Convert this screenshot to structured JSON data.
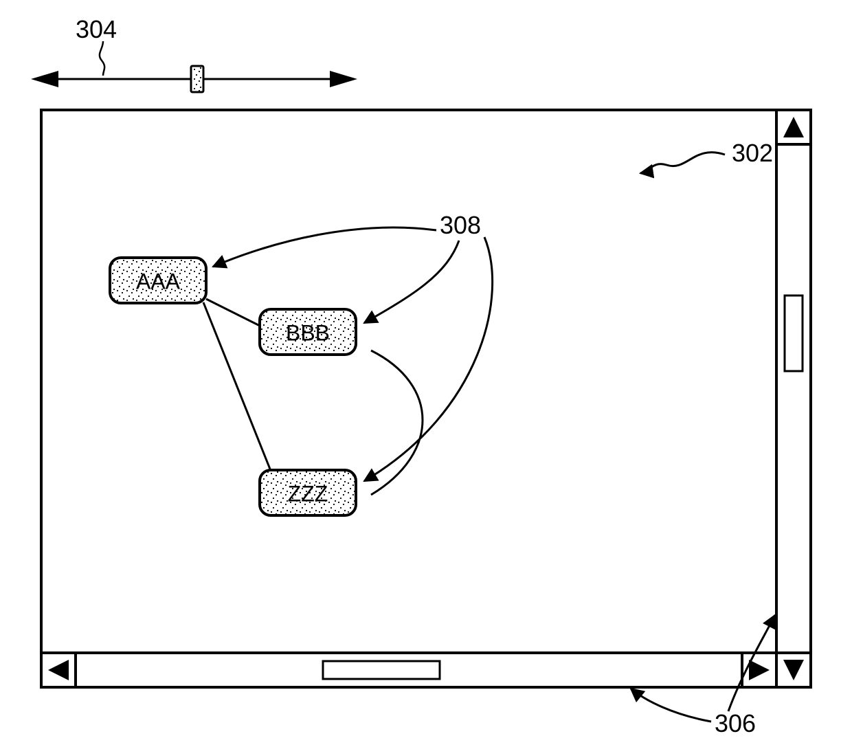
{
  "refs": {
    "slider": "304",
    "canvas": "302",
    "scrollbars": "306",
    "nodes": "308"
  },
  "nodes": {
    "a": "AAA",
    "b": "BBB",
    "z": "ZZZ"
  }
}
